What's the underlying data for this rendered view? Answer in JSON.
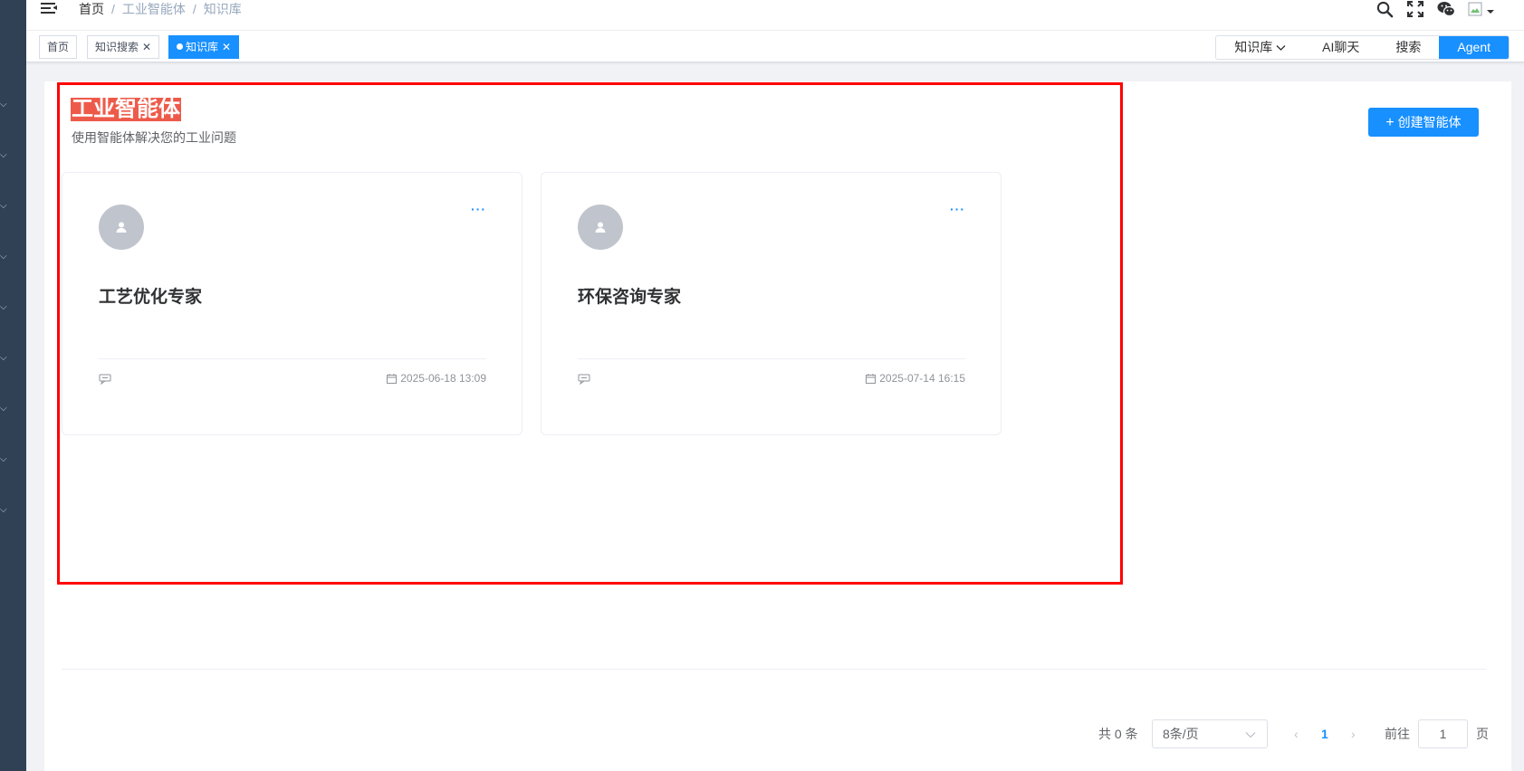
{
  "breadcrumb": {
    "home": "首页",
    "level1": "工业智能体",
    "level2": "知识库"
  },
  "tags": {
    "home": "首页",
    "search": "知识搜索",
    "kb": "知识库"
  },
  "modes": {
    "kb": "知识库",
    "chat": "AI聊天",
    "search": "搜索",
    "agent": "Agent",
    "active": "Agent"
  },
  "page": {
    "title": "工业智能体",
    "subtitle": "使用智能体解决您的工业问题",
    "create_label": "创建智能体"
  },
  "cards": [
    {
      "name": "工艺优化专家",
      "date": "2025-06-18 13:09"
    },
    {
      "name": "环保咨询专家",
      "date": "2025-07-14 16:15"
    }
  ],
  "pagination": {
    "total": "共 0 条",
    "page_size": "8条/页",
    "current_page": "1",
    "goto_label": "前往",
    "goto_value": "1",
    "page_suffix": "页"
  },
  "colors": {
    "accent": "#1890ff",
    "sidebar": "#304156",
    "title_highlight": "#ee5a4a",
    "annotation": "#ff0000"
  }
}
